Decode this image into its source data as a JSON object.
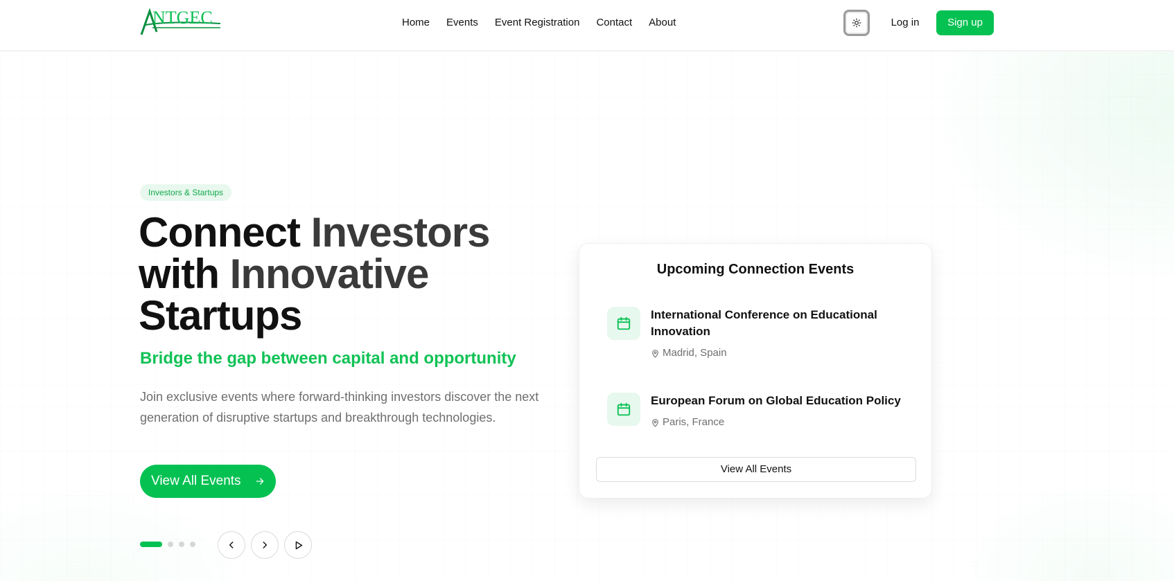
{
  "header": {
    "logo_text": "ANTGEC",
    "nav": [
      "Home",
      "Events",
      "Event Registration",
      "Contact",
      "About"
    ],
    "theme_toggle_icon": "sun-icon",
    "login_label": "Log in",
    "signup_label": "Sign up"
  },
  "hero": {
    "badge": "Investors & Startups",
    "title_line1_a": "Connect",
    "title_line1_b": "Investors",
    "title_line2_a": "with",
    "title_line2_b": "Innovative",
    "title_line3": "Startups",
    "subtitle": "Bridge the gap between capital and opportunity",
    "description": "Join exclusive events where forward-thinking investors discover the next generation of disruptive startups and breakthrough technologies.",
    "cta_label": "View All Events",
    "slides": {
      "count": 4,
      "active": 0
    }
  },
  "events_card": {
    "title": "Upcoming Connection Events",
    "events": [
      {
        "title": "International Conference on Educational Innovation",
        "location": "Madrid, Spain"
      },
      {
        "title": "European Forum on Global Education Policy",
        "location": "Paris, France"
      }
    ],
    "button_label": "View All Events"
  },
  "colors": {
    "accent": "#05c152",
    "accent_light": "#e8f8ee",
    "text_dark": "#111111",
    "text_muted": "#6e6e6e"
  }
}
